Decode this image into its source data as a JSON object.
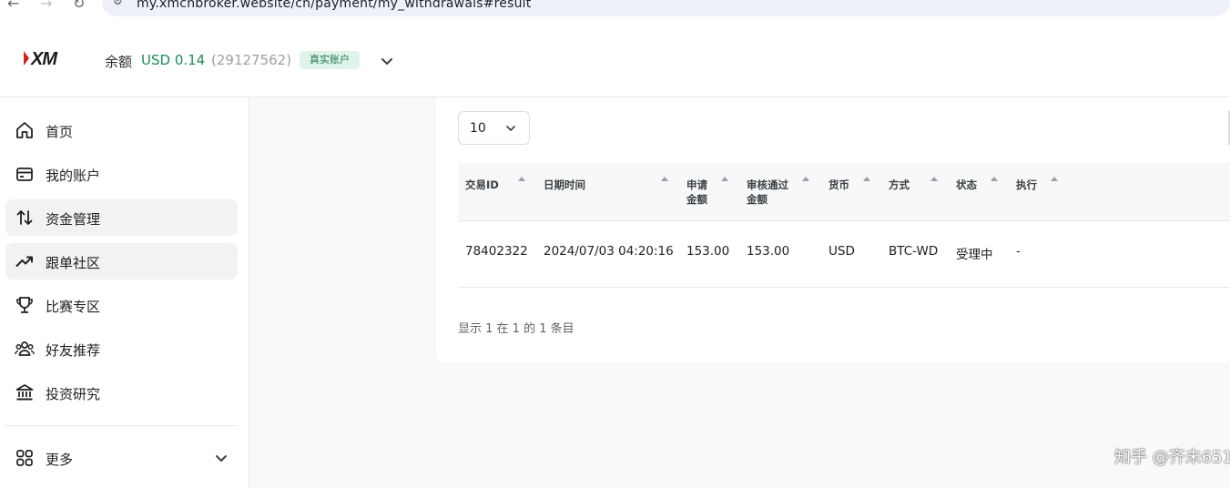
{
  "browser": {
    "url": "my.xmcnbroker.website/cn/payment/my_withdrawals#result"
  },
  "header": {
    "balance_label": "余额",
    "balance_value": "USD 0.14",
    "account_number": "(29127562)",
    "account_type_badge": "真实账户",
    "colors": {
      "brand_red": "#d51f26",
      "balance_green": "#1d8a5a",
      "badge_bg": "#dff3e8"
    }
  },
  "sidebar": {
    "items": [
      {
        "label": "首页",
        "icon": "home-icon",
        "active": false
      },
      {
        "label": "我的账户",
        "icon": "wallet-icon",
        "active": false
      },
      {
        "label": "资金管理",
        "icon": "transfer-arrows-icon",
        "active": true
      },
      {
        "label": "跟单社区",
        "icon": "trending-up-icon",
        "active": true
      },
      {
        "label": "比赛专区",
        "icon": "trophy-icon",
        "active": false
      },
      {
        "label": "好友推荐",
        "icon": "users-icon",
        "active": false
      },
      {
        "label": "投资研究",
        "icon": "bank-icon",
        "active": false
      }
    ],
    "more_label": "更多",
    "more_icon": "grid-icon"
  },
  "table": {
    "page_size": "10",
    "columns": [
      {
        "line1": "交易ID",
        "line2": ""
      },
      {
        "line1": "日期时间",
        "line2": ""
      },
      {
        "line1": "申请",
        "line2": "金额"
      },
      {
        "line1": "审核通过",
        "line2": "金额"
      },
      {
        "line1": "货币",
        "line2": ""
      },
      {
        "line1": "方式",
        "line2": ""
      },
      {
        "line1": "状态",
        "line2": ""
      },
      {
        "line1": "执行",
        "line2": ""
      }
    ],
    "rows": [
      [
        "78402322",
        "2024/07/03 04:20:16",
        "153.00",
        "153.00",
        "USD",
        "BTC-WD",
        "受理中",
        "-"
      ]
    ],
    "footer_info": "显示 1 在 1 的 1 条目"
  },
  "watermark": "知乎 @齐未651"
}
